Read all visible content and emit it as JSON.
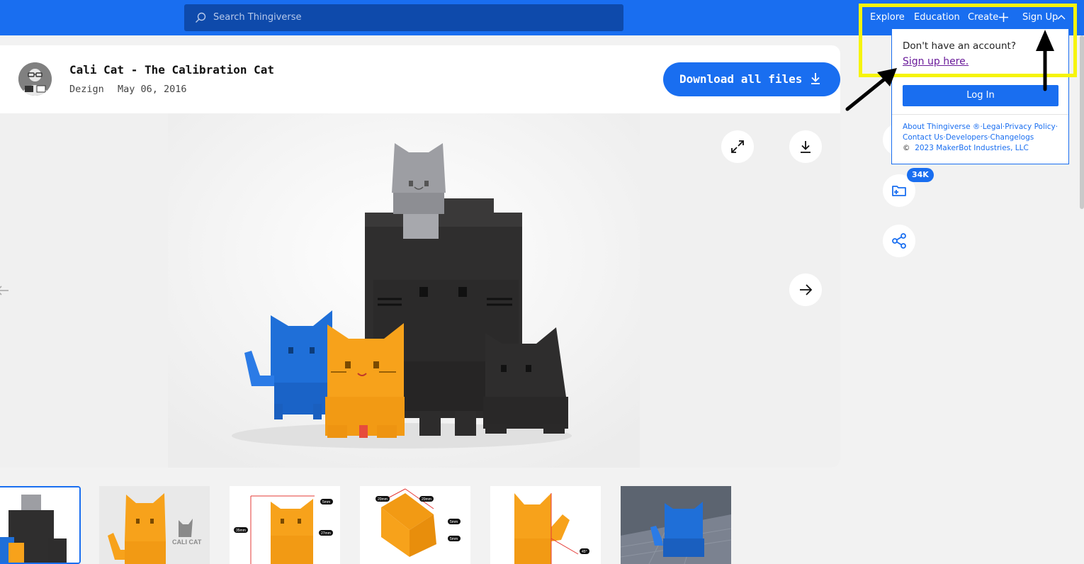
{
  "topbar": {
    "search_placeholder": "Search Thingiverse",
    "nav": {
      "explore": "Explore",
      "education": "Education",
      "create": "Create",
      "signup": "Sign Up"
    },
    "brand_color": "#196ef0"
  },
  "thing": {
    "title": "Cali Cat - The Calibration Cat",
    "author": "Dezign",
    "date": "May 06, 2016",
    "download_label": "Download all files"
  },
  "gallery": {
    "photo_alt": "3D printed calibration cats in gray, black, blue and orange",
    "thumbnails": [
      {
        "name": "thumb-1",
        "label": ""
      },
      {
        "name": "thumb-2",
        "label": "CALI CAT"
      },
      {
        "name": "thumb-3",
        "labels": [
          "5mm",
          "35mm",
          "27mm"
        ]
      },
      {
        "name": "thumb-4",
        "labels": [
          "20mm",
          "20mm",
          "5mm",
          "5mm"
        ]
      },
      {
        "name": "thumb-5",
        "labels": [
          "45°"
        ]
      },
      {
        "name": "thumb-6",
        "label": ""
      }
    ],
    "thumb_selected": 1
  },
  "sidebar": {
    "collections_count": "34K"
  },
  "dropdown": {
    "question": "Don't have an account?",
    "signup_link": "Sign up here.",
    "login_label": "Log In",
    "footer_line1": [
      "About Thingiverse ®",
      "Legal",
      "Privacy Policy"
    ],
    "footer_line2": [
      "Contact Us",
      "Developers",
      "Changelogs"
    ],
    "copyright_symbol": "©",
    "copyright_text": "2023 MakerBot Industries, LLC"
  },
  "colors": {
    "accent": "#196ef0",
    "highlight": "#f6f40a",
    "link_visited": "#6a1b9a"
  },
  "icons": [
    "search-icon",
    "plus-icon",
    "chevron-up-icon",
    "download-icon",
    "expand-icon",
    "arrow-right-icon",
    "arrow-left-icon",
    "folder-add-icon",
    "share-icon"
  ]
}
